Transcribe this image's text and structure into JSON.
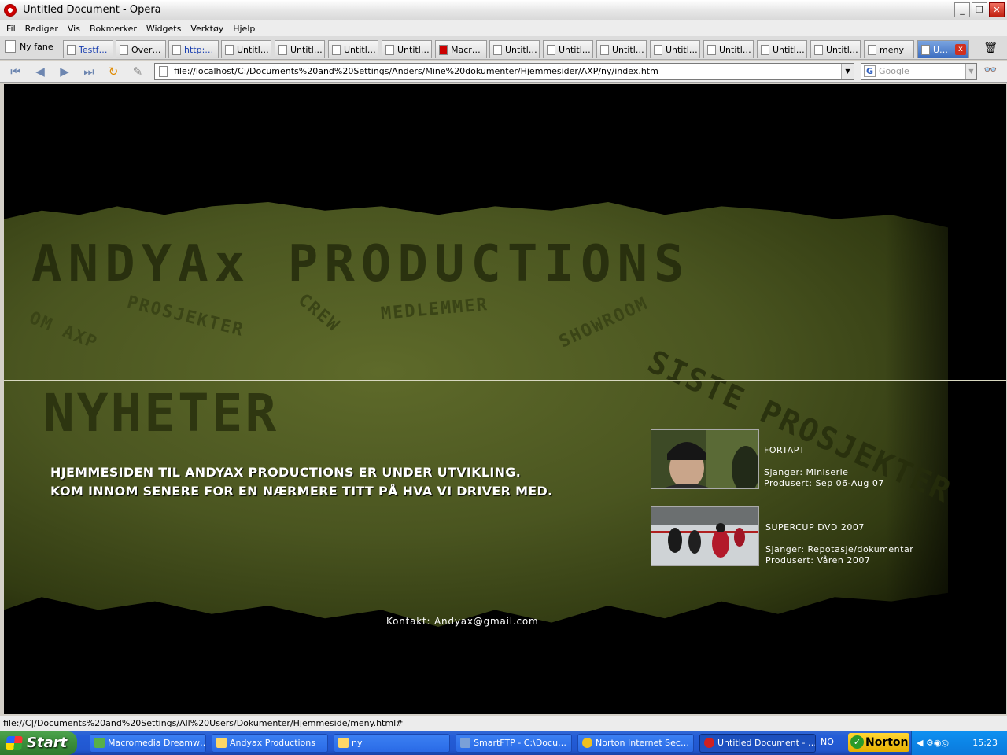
{
  "window": {
    "title": "Untitled Document - Opera",
    "controls": {
      "minimize": "_",
      "restore": "❐",
      "close": "✕"
    }
  },
  "menu": [
    "Fil",
    "Rediger",
    "Vis",
    "Bokmerker",
    "Widgets",
    "Verktøy",
    "Hjelp"
  ],
  "tabs": {
    "new_tab_label": "Ny fane",
    "items": [
      {
        "label": "Testf…"
      },
      {
        "label": "Over…"
      },
      {
        "label": "http:…"
      },
      {
        "label": "Untitl…"
      },
      {
        "label": "Untitl…"
      },
      {
        "label": "Untitl…"
      },
      {
        "label": "Untitl…"
      },
      {
        "label": "Macr…"
      },
      {
        "label": "Untitl…"
      },
      {
        "label": "Untitl…"
      },
      {
        "label": "Untitl…"
      },
      {
        "label": "Untitl…"
      },
      {
        "label": "Untitl…"
      },
      {
        "label": "Untitl…"
      },
      {
        "label": "Untitl…"
      },
      {
        "label": "meny"
      },
      {
        "label": "U…"
      }
    ],
    "close_label": "x"
  },
  "address_bar": {
    "url": "file://localhost/C:/Documents%20and%20Settings/Anders/Mine%20dokumenter/Hjemmesider/AXP/ny/index.htm",
    "search_placeholder": "Google"
  },
  "page": {
    "logo_text": "ANDYAx PRODUCTIONS",
    "nav": {
      "om": "OM AXP",
      "prosjekter": "PROSJEKTER",
      "crew": "CREW",
      "medlemmer": "MEDLEMMER",
      "showroom": "SHOWROOM",
      "siste_prosjekter": "SISTE PROSJEKTER"
    },
    "news_heading": "NYHETER",
    "intro_lines": [
      "Hjemmesiden til Andyax Productions er under utvikling.",
      "Kom innom senere for en nærmere titt på hva vi driver med."
    ],
    "projects": [
      {
        "title": "FORTAPT",
        "genre": "Sjanger: Miniserie",
        "produced": "Produsert: Sep 06-Aug 07"
      },
      {
        "title": "SUPERCUP DVD 2007",
        "genre": "Sjanger: Repotasje/dokumentar",
        "produced": "Produsert: Våren 2007"
      }
    ],
    "contact": "Kontakt: Andyax@gmail.com"
  },
  "status_bar": "file://C|/Documents%20and%20Settings/All%20Users/Dokumenter/Hjemmeside/meny.html#",
  "taskbar": {
    "start": "Start",
    "items": [
      {
        "label": "Macromedia Dreamw…"
      },
      {
        "label": "Andyax Productions"
      },
      {
        "label": "ny"
      },
      {
        "label": "SmartFTP - C:\\Docu…"
      },
      {
        "label": "Norton Internet Sec…"
      },
      {
        "label": "Untitled Document - …"
      }
    ],
    "lang": "NO",
    "norton": "Norton",
    "clock": "15:23"
  }
}
